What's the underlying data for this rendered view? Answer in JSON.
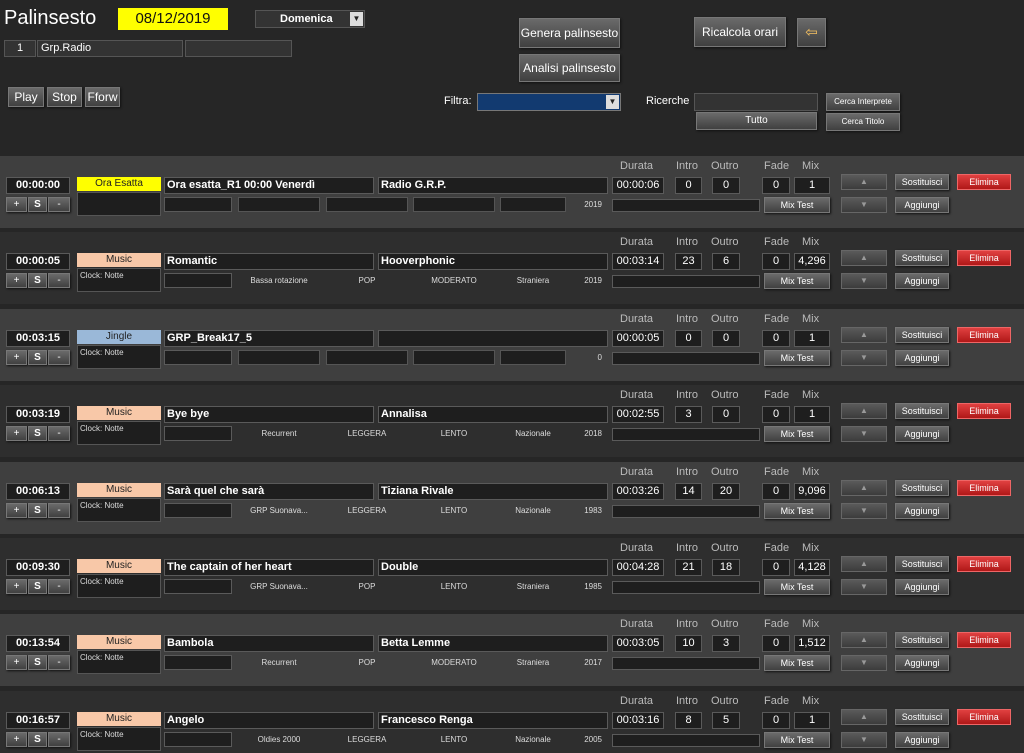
{
  "header": {
    "title": "Palinsesto",
    "date": "08/12/2019",
    "day": "Domenica",
    "group_num": "1",
    "group_name": "Grp.Radio",
    "btn_genera": "Genera palinsesto",
    "btn_analisi": "Analisi palinsesto",
    "btn_ricalcola": "Ricalcola orari",
    "btn_play": "Play",
    "btn_stop": "Stop",
    "btn_fforw": "Fforw",
    "filtra_label": "Filtra:",
    "ricerche_label": "Ricerche",
    "btn_tutto": "Tutto",
    "btn_cerca_interprete": "Cerca Interprete",
    "btn_cerca_titolo": "Cerca Titolo",
    "exit_icon": "exit-door-icon"
  },
  "columns": {
    "durata": "Durata",
    "intro": "Intro",
    "outro": "Outro",
    "fade": "Fade",
    "mix": "Mix"
  },
  "buttons": {
    "plus": "+",
    "s": "S",
    "minus": "-",
    "mixtest": "Mix Test",
    "sostituisci": "Sostituisci",
    "aggiungi": "Aggiungi",
    "elimina": "Elimina"
  },
  "rows": [
    {
      "time": "00:00:00",
      "tag": "Ora Esatta",
      "tag_color": "#ffff00",
      "clock": "",
      "title": "Ora esatta_R1 00:00 Venerdì",
      "artist": "Radio G.R.P.",
      "rotation": "",
      "genre": "",
      "tempo": "",
      "origin": "",
      "year": "2019",
      "durata": "00:00:06",
      "intro": "0",
      "outro": "0",
      "fade": "0",
      "mix": "1"
    },
    {
      "time": "00:00:05",
      "tag": "Music",
      "tag_color": "#f8c8a8",
      "clock": "Clock: Notte",
      "title": "Romantic",
      "artist": "Hooverphonic",
      "rotation": "Bassa rotazione",
      "genre": "POP",
      "tempo": "MODERATO",
      "origin": "Straniera",
      "year": "2019",
      "durata": "00:03:14",
      "intro": "23",
      "outro": "6",
      "fade": "0",
      "mix": "4,296"
    },
    {
      "time": "00:03:15",
      "tag": "Jingle",
      "tag_color": "#9ab8d8",
      "clock": "Clock: Notte",
      "title": "GRP_Break17_5",
      "artist": "",
      "rotation": "",
      "genre": "",
      "tempo": "",
      "origin": "",
      "year": "0",
      "durata": "00:00:05",
      "intro": "0",
      "outro": "0",
      "fade": "0",
      "mix": "1"
    },
    {
      "time": "00:03:19",
      "tag": "Music",
      "tag_color": "#f8c8a8",
      "clock": "Clock: Notte",
      "title": "Bye bye",
      "artist": "Annalisa",
      "rotation": "Recurrent",
      "genre": "LEGGERA",
      "tempo": "LENTO",
      "origin": "Nazionale",
      "year": "2018",
      "durata": "00:02:55",
      "intro": "3",
      "outro": "0",
      "fade": "0",
      "mix": "1"
    },
    {
      "time": "00:06:13",
      "tag": "Music",
      "tag_color": "#f8c8a8",
      "clock": "Clock: Notte",
      "title": "Sarà quel che sarà",
      "artist": "Tiziana Rivale",
      "rotation": "GRP Suonava...",
      "genre": "LEGGERA",
      "tempo": "LENTO",
      "origin": "Nazionale",
      "year": "1983",
      "durata": "00:03:26",
      "intro": "14",
      "outro": "20",
      "fade": "0",
      "mix": "9,096"
    },
    {
      "time": "00:09:30",
      "tag": "Music",
      "tag_color": "#f8c8a8",
      "clock": "Clock: Notte",
      "title": "The captain of her heart",
      "artist": "Double",
      "rotation": "GRP Suonava...",
      "genre": "POP",
      "tempo": "LENTO",
      "origin": "Straniera",
      "year": "1985",
      "durata": "00:04:28",
      "intro": "21",
      "outro": "18",
      "fade": "0",
      "mix": "4,128"
    },
    {
      "time": "00:13:54",
      "tag": "Music",
      "tag_color": "#f8c8a8",
      "clock": "Clock: Notte",
      "title": "Bambola",
      "artist": "Betta Lemme",
      "rotation": "Recurrent",
      "genre": "POP",
      "tempo": "MODERATO",
      "origin": "Straniera",
      "year": "2017",
      "durata": "00:03:05",
      "intro": "10",
      "outro": "3",
      "fade": "0",
      "mix": "1,512"
    },
    {
      "time": "00:16:57",
      "tag": "Music",
      "tag_color": "#f8c8a8",
      "clock": "Clock: Notte",
      "title": "Angelo",
      "artist": "Francesco Renga",
      "rotation": "Oldies 2000",
      "genre": "LEGGERA",
      "tempo": "LENTO",
      "origin": "Nazionale",
      "year": "2005",
      "durata": "00:03:16",
      "intro": "8",
      "outro": "5",
      "fade": "0",
      "mix": "1"
    }
  ]
}
